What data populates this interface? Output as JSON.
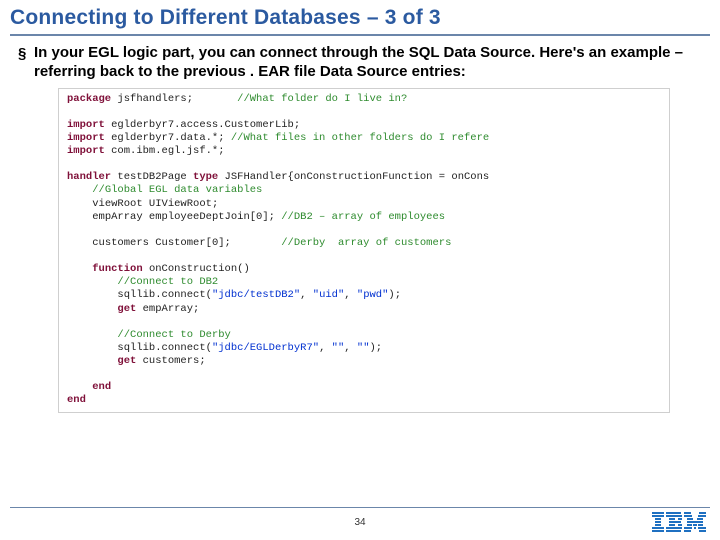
{
  "slide": {
    "title": "Connecting to Different Databases – 3 of 3",
    "bullet_glyph": "§",
    "bullet_text": "In your EGL logic part, you can connect through the SQL Data Source. Here's an example – referring back to the previous . EAR file Data Source entries:",
    "page_number": "34",
    "logo_label": "IBM"
  },
  "code": {
    "l01_kw": "package",
    "l01_rest": " jsfhandlers;       ",
    "l01_cmt": "//What folder do I live in?",
    "l02": "",
    "l03_kw": "import",
    "l03_rest": " eglderbyr7.access.CustomerLib;",
    "l04_kw": "import",
    "l04_rest": " eglderbyr7.data.*; ",
    "l04_cmt": "//What files in other folders do I refere",
    "l05_kw": "import",
    "l05_rest": " com.ibm.egl.jsf.*;",
    "l06": "",
    "l07_kw": "handler",
    "l07_rest": " testDB2Page ",
    "l07_kw2": "type",
    "l07_rest2": " JSFHandler{onConstructionFunction = onCons",
    "l08_ind": "    ",
    "l08_cmt": "//Global EGL data variables",
    "l09_ind": "    ",
    "l09_txt": "viewRoot UIViewRoot;",
    "l10_ind": "    ",
    "l10_txt": "empArray employeeDeptJoin[0]; ",
    "l10_cmt": "//DB2 – array of employees",
    "l11": "",
    "l12_ind": "    ",
    "l12_txt": "customers Customer[0];        ",
    "l12_cmt": "//Derby  array of customers",
    "l13": "",
    "l14_ind": "    ",
    "l14_kw": "function",
    "l14_rest": " onConstruction()",
    "l15_ind": "        ",
    "l15_cmt": "//Connect to DB2",
    "l16_ind": "        ",
    "l16_a": "sqllib.connect(",
    "l16_s1": "\"jdbc/testDB2\"",
    "l16_b": ", ",
    "l16_s2": "\"uid\"",
    "l16_c": ", ",
    "l16_s3": "\"pwd\"",
    "l16_d": ");",
    "l17_ind": "        ",
    "l17_kw": "get",
    "l17_rest": " empArray;",
    "l18": "",
    "l19_ind": "        ",
    "l19_cmt": "//Connect to Derby",
    "l20_ind": "        ",
    "l20_a": "sqllib.connect(",
    "l20_s1": "\"jdbc/EGLDerbyR7\"",
    "l20_b": ", ",
    "l20_s2": "\"\"",
    "l20_c": ", ",
    "l20_s3": "\"\"",
    "l20_d": ");",
    "l21_ind": "        ",
    "l21_kw": "get",
    "l21_rest": " customers;",
    "l22": "",
    "l23_ind": "    ",
    "l23_kw": "end",
    "l24_kw": "end"
  }
}
